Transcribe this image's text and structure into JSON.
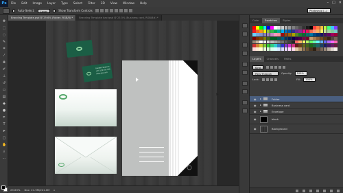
{
  "app": {
    "logo": "Ps",
    "menu": [
      "File",
      "Edit",
      "Image",
      "Layer",
      "Type",
      "Select",
      "Filter",
      "3D",
      "View",
      "Window",
      "Help"
    ],
    "window_buttons": [
      "–",
      "□",
      "✕"
    ],
    "workspace": "Photoshop (...)"
  },
  "options": {
    "auto_select_label": "Auto-Select:",
    "auto_select_value": "Layer",
    "transform_label": "Show Transform Controls"
  },
  "tabs": [
    {
      "label": "Branding Template.psd @ 29.6% (Folder, RGB/8) *",
      "active": true
    },
    {
      "label": "Branding Template backpsd @ 23.5% (Business card, RGB/8#) *",
      "active": false
    }
  ],
  "status": {
    "zoom": "29.63%",
    "doc_info": "Doc: 21.9M/221.0M"
  },
  "artwork": {
    "bcard_logo_text": "",
    "bcard_contact_name": "George Ferguson",
    "bcard_contact_line1": "+00 123 456 789",
    "bcard_contact_line2": "www.site.com",
    "env_logo_text": "",
    "back_env_logo_text": ""
  },
  "color_panel": {
    "tabs": [
      {
        "label": "Color",
        "active": false
      },
      {
        "label": "Swatches",
        "active": true
      },
      {
        "label": "Styles",
        "active": false
      }
    ],
    "colors": [
      "#ff0000",
      "#ffff00",
      "#00ff00",
      "#00ffff",
      "#0000ff",
      "#ff00ff",
      "#ffffff",
      "#e6e6e6",
      "#cccccc",
      "#b3b3b3",
      "#999999",
      "#808080",
      "#666666",
      "#4d4d4d",
      "#333333",
      "#1a1a1a",
      "#000000",
      "#ff4040",
      "#ff8040",
      "#ffc040",
      "#c0ff40",
      "#40ff80",
      "#40c0ff",
      "#8040ff",
      "#ee1d24",
      "#f26521",
      "#f7941d",
      "#fff200",
      "#8dc63f",
      "#39b54a",
      "#00a651",
      "#00a99d",
      "#00aeef",
      "#0072bc",
      "#0054a6",
      "#2e3192",
      "#662d91",
      "#92278f",
      "#ec008c",
      "#ed145b",
      "#f26c4f",
      "#f69679",
      "#fbaf5d",
      "#fff568",
      "#c4df9b",
      "#a2d39c",
      "#82ca9c",
      "#7accc8",
      "#6dcff6",
      "#7da7d9",
      "#8393ca",
      "#8781bd",
      "#a187be",
      "#bd8cbf",
      "#f49ac1",
      "#f5989d",
      "#9e0b0f",
      "#a0410d",
      "#a36209",
      "#aba000",
      "#598527",
      "#197b30",
      "#007236",
      "#00746b",
      "#0076a3",
      "#004a80",
      "#003471",
      "#1b1464",
      "#440e62",
      "#630460",
      "#9e005d",
      "#9e0039",
      "#790000",
      "#7b2e00",
      "#7d4900",
      "#827b00",
      "#406618",
      "#005e20",
      "#005826",
      "#005952",
      "#005b7f",
      "#003663",
      "#002157",
      "#0d004c",
      "#32004b",
      "#4b0049",
      "#7b0046",
      "#7a0026",
      "#c69c6d",
      "#a67c52",
      "#8c6239",
      "#754c24",
      "#603913",
      "#3c2415",
      "#534741",
      "#736357",
      "#998675",
      "#c7b299",
      "#ffffff",
      "#f2f2f2",
      "#d9d9d9",
      "#bfbfbf",
      "#a6a6a6",
      "#8c8c8c",
      "#737373",
      "#595959",
      "#404040",
      "#262626",
      "#ff6666",
      "#ffb366",
      "#ffff66",
      "#b3ff66",
      "#66ff66",
      "#66ffb3",
      "#66ffff",
      "#66b3ff",
      "#6666ff",
      "#b366ff",
      "#ff66ff",
      "#ff66b3",
      "#cc3333",
      "#cc8033",
      "#cccc33",
      "#80cc33",
      "#33cc33",
      "#33cc80",
      "#33cccc",
      "#3380cc",
      "#3333cc",
      "#8033cc",
      "#cc33cc",
      "#cc3380",
      "#661a1a",
      "#66401a",
      "#66661a",
      "#40661a",
      "#1a661a",
      "#1a6640",
      "#1a6666",
      "#1a4066",
      "#1a1a66",
      "#401a66",
      "#661a66",
      "#661a40",
      "#ffd9d9",
      "#ffecd9",
      "#ffffd9",
      "#ecffd9",
      "#d9ffd9",
      "#d9ffec",
      "#d9ffff",
      "#d9ecff",
      "#d9d9ff",
      "#ecd9ff",
      "#ffd9ff",
      "#ffd9ec",
      "#e0c9a6",
      "#b89b72",
      "#8f7350",
      "#6b5233",
      "#4a3620",
      "#2e2012",
      "#5c4a3d",
      "#7a6758",
      "#9b8a7b",
      "#bdb0a3",
      "#ded6ce",
      "#f5f0eb"
    ]
  },
  "layers_panel": {
    "tabs": [
      {
        "label": "Layers",
        "active": true
      },
      {
        "label": "Channels",
        "active": false
      },
      {
        "label": "Paths",
        "active": false
      }
    ],
    "kind_label": "Kind",
    "blend_mode": "Pass Through",
    "opacity_label": "Opacity:",
    "opacity_value": "100%",
    "lock_label": "Lock:",
    "fill_label": "Fill:",
    "fill_value": "100%",
    "layers": [
      {
        "name": "Folder",
        "type": "group",
        "selected": true
      },
      {
        "name": "Business card",
        "type": "group",
        "selected": false
      },
      {
        "name": "Envelope",
        "type": "group",
        "selected": false
      },
      {
        "name": "black",
        "type": "layer",
        "thumb": "black",
        "selected": false
      },
      {
        "name": "Background",
        "type": "layer",
        "thumb": "wood",
        "selected": false
      }
    ]
  }
}
